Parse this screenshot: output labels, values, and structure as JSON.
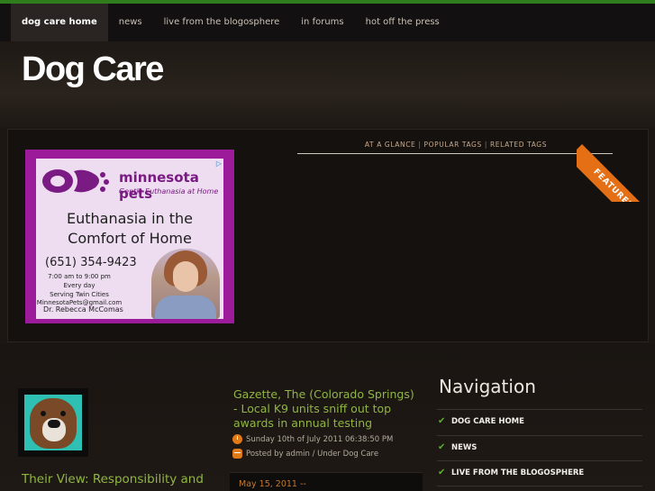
{
  "nav": {
    "items": [
      {
        "label": "dog care home",
        "active": true
      },
      {
        "label": "news",
        "active": false
      },
      {
        "label": "live from the blogosphere",
        "active": false
      },
      {
        "label": "in forums",
        "active": false
      },
      {
        "label": "hot off the press",
        "active": false
      }
    ]
  },
  "header": {
    "title": "Dog Care"
  },
  "featured": {
    "ribbon": "FEATURED",
    "tabs": [
      "AT A GLANCE",
      "POPULAR TAGS",
      "RELATED TAGS"
    ],
    "ad": {
      "brand": "minnesota pets",
      "tagline": "Gentle Euthanasia at Home",
      "headline_1": "Euthanasia in the",
      "headline_2": "Comfort of Home",
      "phone": "(651) 354-9423",
      "hours": "7:00 am to 9:00 pm",
      "days": "Every day",
      "area": "Serving Twin Cities",
      "email": "MinnesotaPets@gmail.com",
      "doctor": "Dr. Rebecca McComas"
    }
  },
  "left_post": {
    "title": "Their View: Responsibility and"
  },
  "post": {
    "title": "Gazette, The (Colorado Springs) - Local K9 units sniff out top awards in annual testing",
    "date": "Sunday 10th of July 2011 06:38:50 PM",
    "byline": "Posted by admin / Under Dog Care",
    "next_date": "May 15, 2011 --"
  },
  "sidebar": {
    "title": "Navigation",
    "items": [
      "DOG CARE HOME",
      "NEWS",
      "LIVE FROM THE BLOGOSPHERE"
    ]
  },
  "colors": {
    "accent_green": "#8fb542",
    "ribbon_orange": "#e56f15",
    "ad_purple": "#9b1b9b"
  },
  "icons": {
    "check": "check-icon",
    "clock": "clock-icon",
    "comment": "comment-icon"
  }
}
